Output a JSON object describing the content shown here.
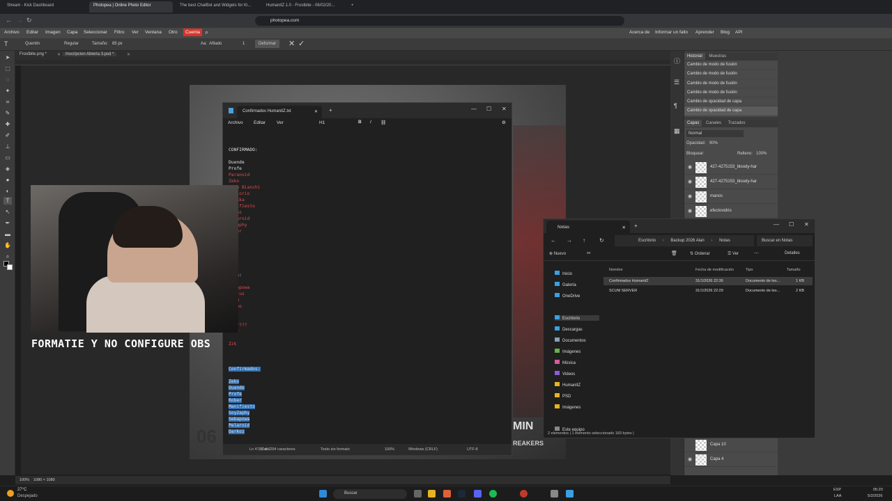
{
  "browser": {
    "tabs": [
      {
        "label": "Stream - Kick Dashboard",
        "active": false
      },
      {
        "label": "Photopea | Online Photo Editor",
        "active": true
      },
      {
        "label": "The best ChatBot and Widgets for Ki...",
        "active": false
      },
      {
        "label": "HumanitZ 1.0 - Frostbite - 06/02/20...",
        "active": false
      }
    ],
    "new_tab": "+",
    "url": "photopea.com"
  },
  "photopea": {
    "menus": [
      "Archivo",
      "Editar",
      "Imagen",
      "Capa",
      "Seleccionar",
      "Filtro",
      "Ver",
      "Ventana",
      "Otro",
      "Cuenta"
    ],
    "right_links": [
      "Acerca de",
      "Informar un fallo",
      "Aprender",
      "Blog",
      "API"
    ],
    "options": {
      "font": "Quentin",
      "style": "Regular",
      "size_label": "Tamaño:",
      "size_value": "85 px",
      "aa_label": "Aa:",
      "aa_value": "Afilado",
      "spacing": "1",
      "warp": "Deformar"
    },
    "doc_tabs": [
      "Frostbite.png *",
      "Inscripcion Abierta 3.psd *"
    ],
    "status": {
      "zoom": "100%",
      "size": "1080 × 1080"
    },
    "canvas_number": "06",
    "canvas_text": "MIN",
    "canvas_text2": "REAKERS",
    "history": {
      "tabs": [
        "Historial",
        "Muestras"
      ],
      "items": [
        "Cambio de modo de fusión",
        "Cambio de modo de fusión",
        "Cambio de modo de fusión",
        "Cambio de modo de fusión",
        "Cambio de opacidad de capa",
        "Cambio de opacidad de capa"
      ]
    },
    "layers": {
      "tabs": [
        "Capas",
        "Canales",
        "Trazados"
      ],
      "blend": "Normal",
      "opacity_label": "Opacidad:",
      "opacity_value": "90%",
      "lock_label": "Bloquear:",
      "fill_label": "Relleno:",
      "fill_value": "100%",
      "items": [
        "427-4275153_bloody-har",
        "427-4275153_bloody-har",
        "manos",
        "efectovidrio",
        "Capa 10",
        "Capa 4"
      ]
    }
  },
  "notepad": {
    "tab_title": "Confirmados HumanitZ.txt",
    "menus": [
      "Archivo",
      "Editar",
      "Ver"
    ],
    "heading": "H1",
    "lines_a": [
      "CONFIRMADO:",
      "",
      "Duende",
      "Profe",
      "Paranoid",
      "Zeko",
      "Nico Bianchi",
      "Brujorio",
      "...kka",
      "...ifiesto",
      "...oz",
      "...aroid",
      "...aphy",
      "...er"
    ],
    "lines_b": [
      "...s:",
      "",
      "...apowa",
      "...tus",
      "...u",
      "...ho",
      "",
      "",
      "...????",
      "...r",
      "",
      "Zzk"
    ],
    "lines_sel": [
      "Confirmados:",
      "",
      "Zeko",
      "Duende",
      "Profe",
      "Rober",
      "Manifiesto",
      "SoyZaphy",
      "Sebapowa",
      "Pelaroid",
      "Darkoz"
    ],
    "status": {
      "pos": "Ln 47, Col 1",
      "chars": "83 de 294 caracteres",
      "format": "Texto sin formato",
      "zoom": "100%",
      "eol": "Windows (CRLF)",
      "enc": "UTF-8"
    }
  },
  "stream": {
    "caption": "FORMATIE Y NO CONFIGURE OBS"
  },
  "explorer": {
    "tab_title": "Notas",
    "breadcrumb": [
      "Escritorio",
      "Backup 2026 Alan",
      "Notas"
    ],
    "search_placeholder": "Buscar en Notas",
    "commands": {
      "new": "Nuevo",
      "sort": "Ordenar",
      "view": "Ver",
      "details": "Detalles"
    },
    "nav": [
      "Inicio",
      "Galería",
      "OneDrive",
      "Escritorio",
      "Descargas",
      "Documentos",
      "Imágenes",
      "Música",
      "Videos",
      "HumanitZ",
      "PSD",
      "Imágenes",
      "Este equipo"
    ],
    "columns": [
      "Nombre",
      "Fecha de modificación",
      "Tipo",
      "Tamaño"
    ],
    "files": [
      {
        "name": "Confirmados HumanitZ",
        "date": "31/1/2026 22:36",
        "type": "Documento de tex...",
        "size": "1 KB"
      },
      {
        "name": "SCUM SERVER",
        "date": "31/1/2026 22:29",
        "type": "Documento de tex...",
        "size": "2 KB"
      }
    ],
    "status": "2 elementos  |  1 elemento seleccionado  183 bytes  |"
  },
  "taskbar": {
    "weather_temp": "27°C",
    "weather_desc": "Despejado",
    "search": "Buscar",
    "lang": "ESP",
    "lang2": "LAA",
    "time": "05:20",
    "date": "5/2/2026"
  },
  "colors": {
    "accent_red": "#e04b4b",
    "selection": "#2f6fb5",
    "cuenta": "#d9342b"
  }
}
